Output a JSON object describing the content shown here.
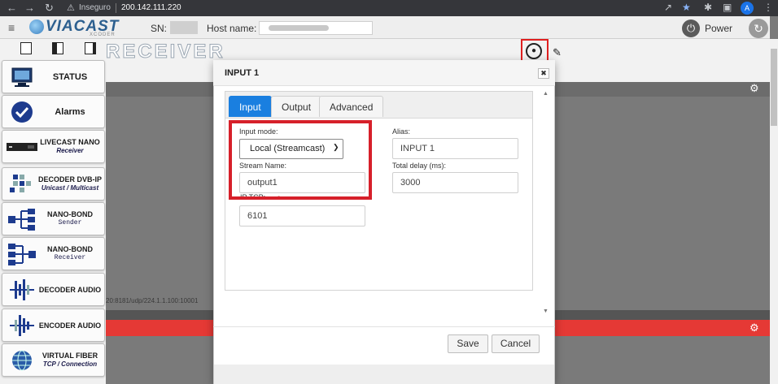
{
  "browser": {
    "insecure_label": "Inseguro",
    "url": "200.142.111.220"
  },
  "header": {
    "logo_text": "VIACAST",
    "logo_sub": "XCODER",
    "sn_label": "SN:",
    "host_label": "Host name:",
    "power_label": "Power"
  },
  "page": {
    "title": "RECEIVER",
    "url_snippet": "20:8181/udp/224.1.1.100:10001"
  },
  "sidebar": {
    "items": [
      {
        "label": "STATUS",
        "sub": ""
      },
      {
        "label": "Alarms",
        "sub": ""
      },
      {
        "label": "LIVECAST NANO",
        "sub": "Receiver"
      },
      {
        "label": "DECODER DVB-IP",
        "sub": "Unicast / Multicast"
      },
      {
        "label": "NANO-BOND",
        "sub": "Sender"
      },
      {
        "label": "NANO-BOND",
        "sub": "Receiver"
      },
      {
        "label": "DECODER AUDIO",
        "sub": ""
      },
      {
        "label": "ENCODER AUDIO",
        "sub": ""
      },
      {
        "label": "VIRTUAL FIBER",
        "sub": "TCP / Connection"
      }
    ]
  },
  "modal": {
    "title": "INPUT 1",
    "tabs": [
      {
        "label": "Input",
        "active": true
      },
      {
        "label": "Output",
        "active": false
      },
      {
        "label": "Advanced",
        "active": false
      }
    ],
    "fields": {
      "input_mode_label": "Input mode:",
      "input_mode_value": "Local (Streamcast)",
      "stream_name_label": "Stream Name:",
      "stream_name_value": "output1",
      "ip_port_label": "IP TCP:",
      "ip_port_value": "6101",
      "alias_label": "Alias:",
      "alias_value": "INPUT 1",
      "delay_label": "Total delay (ms):",
      "delay_value": "3000"
    },
    "save_label": "Save",
    "cancel_label": "Cancel"
  },
  "colors": {
    "accent": "#1a7fe0",
    "highlight": "#d6202a",
    "alert_band": "#e53935"
  }
}
